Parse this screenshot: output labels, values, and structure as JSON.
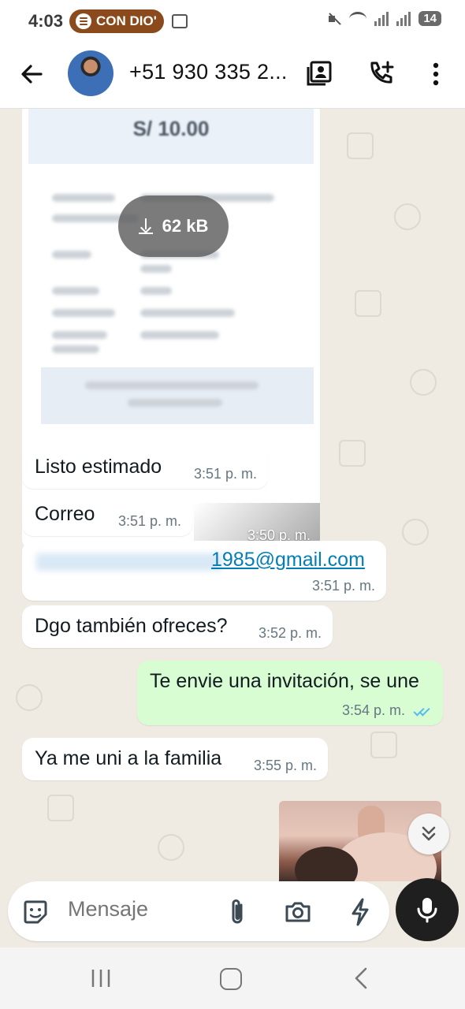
{
  "status_bar": {
    "time": "4:03",
    "spotify_label": "CON DIO'",
    "battery": "14"
  },
  "header": {
    "contact_name": "+51 930 335 2..."
  },
  "messages": [
    {
      "type": "image",
      "direction": "in",
      "amount": "S/ 10.00",
      "download_size": "62 kB",
      "time": "3:50 p. m."
    },
    {
      "type": "text",
      "direction": "in",
      "text": "Listo estimado",
      "time": "3:51 p. m."
    },
    {
      "type": "text",
      "direction": "in",
      "text": "Correo",
      "time": "3:51 p. m."
    },
    {
      "type": "link",
      "direction": "in",
      "text": "1985@gmail.com",
      "time": "3:51 p. m."
    },
    {
      "type": "text",
      "direction": "in",
      "text": "Dgo también ofreces?",
      "time": "3:52 p. m."
    },
    {
      "type": "text",
      "direction": "out",
      "text": "Te envie una invitación, se une",
      "time": "3:54 p. m.",
      "status": "read"
    },
    {
      "type": "text",
      "direction": "in",
      "text": "Ya me uni a la familia",
      "time": "3:55 p. m."
    }
  ],
  "composer": {
    "placeholder": "Mensaje"
  },
  "colors": {
    "chat_background": "#efeae2",
    "outgoing_bubble": "#d9fdd3",
    "link": "#027eb5",
    "read_ticks": "#53bdeb"
  }
}
